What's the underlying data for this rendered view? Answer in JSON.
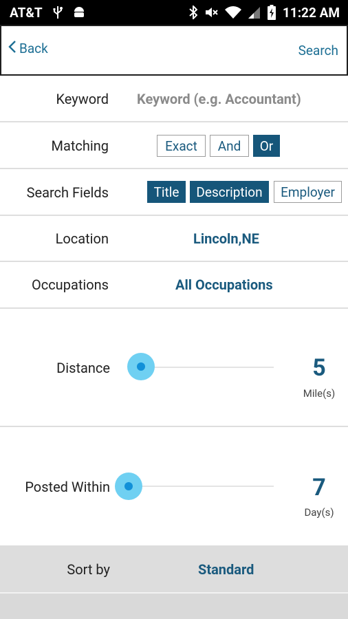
{
  "status_bar": {
    "carrier": "AT&T",
    "time": "11:22 AM"
  },
  "header": {
    "back_label": "Back",
    "search_label": "Search"
  },
  "keyword": {
    "label": "Keyword",
    "placeholder": "Keyword (e.g. Accountant)"
  },
  "matching": {
    "label": "Matching",
    "options": [
      "Exact",
      "And",
      "Or"
    ],
    "selected": "Or"
  },
  "search_fields": {
    "label": "Search Fields",
    "options": [
      "Title",
      "Description",
      "Employer"
    ],
    "selected": [
      "Title",
      "Description"
    ]
  },
  "location": {
    "label": "Location",
    "value": "Lincoln,NE"
  },
  "occupations": {
    "label": "Occupations",
    "value": "All Occupations"
  },
  "distance": {
    "label": "Distance",
    "value": "5",
    "unit": "Mile(s)",
    "level": 0.1
  },
  "posted_within": {
    "label": "Posted Within",
    "value": "7",
    "unit": "Day(s)",
    "level": 0.0
  },
  "sort": {
    "label": "Sort by",
    "value": "Standard"
  },
  "colors": {
    "accent": "#16567a",
    "link": "#1d6f94",
    "slider": "#1190d8",
    "slider_halo": "#6fd0f2"
  }
}
